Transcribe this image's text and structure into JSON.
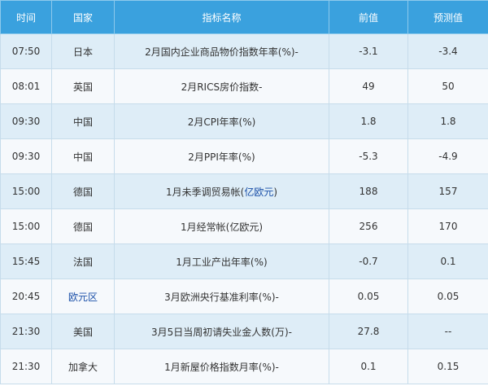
{
  "headers": {
    "time": "时间",
    "country": "国家",
    "indicator": "指标名称",
    "previous": "前值",
    "forecast": "预测值"
  },
  "rows": [
    {
      "time": "07:50",
      "country": "日本",
      "indicator": "2月国内企业商品物价指数年率(%)-",
      "previous": "-3.1",
      "forecast": "-3.4"
    },
    {
      "time": "08:01",
      "country": "英国",
      "indicator": "2月RICS房价指数-",
      "previous": "49",
      "forecast": "50"
    },
    {
      "time": "09:30",
      "country": "中国",
      "indicator": "2月CPI年率(%)",
      "previous": "1.8",
      "forecast": "1.8"
    },
    {
      "time": "09:30",
      "country": "中国",
      "indicator": "2月PPI年率(%)",
      "previous": "-5.3",
      "forecast": "-4.9"
    },
    {
      "time": "15:00",
      "country": "德国",
      "indicator_prefix": "1月未季调贸易帐(",
      "indicator_link": "亿欧元",
      "indicator_suffix": ")",
      "previous": "188",
      "forecast": "157"
    },
    {
      "time": "15:00",
      "country": "德国",
      "indicator": "1月经常帐(亿欧元)",
      "previous": "256",
      "forecast": "170"
    },
    {
      "time": "15:45",
      "country": "法国",
      "indicator": "1月工业产出年率(%)",
      "previous": "-0.7",
      "forecast": "0.1"
    },
    {
      "time": "20:45",
      "country": "欧元区",
      "indicator": "3月欧洲央行基准利率(%)-",
      "previous": "0.05",
      "forecast": "0.05"
    },
    {
      "time": "21:30",
      "country": "美国",
      "indicator": "3月5日当周初请失业金人数(万)-",
      "previous": "27.8",
      "forecast": "--"
    },
    {
      "time": "21:30",
      "country": "加拿大",
      "indicator": "1月新屋价格指数月率(%)-",
      "previous": "0.1",
      "forecast": "0.15"
    }
  ],
  "colors": {
    "header_bg": "#3aa1de",
    "row_alt_bg": "#deedf7",
    "row_bg": "#f6f9fc",
    "link": "#1a4fa8"
  }
}
